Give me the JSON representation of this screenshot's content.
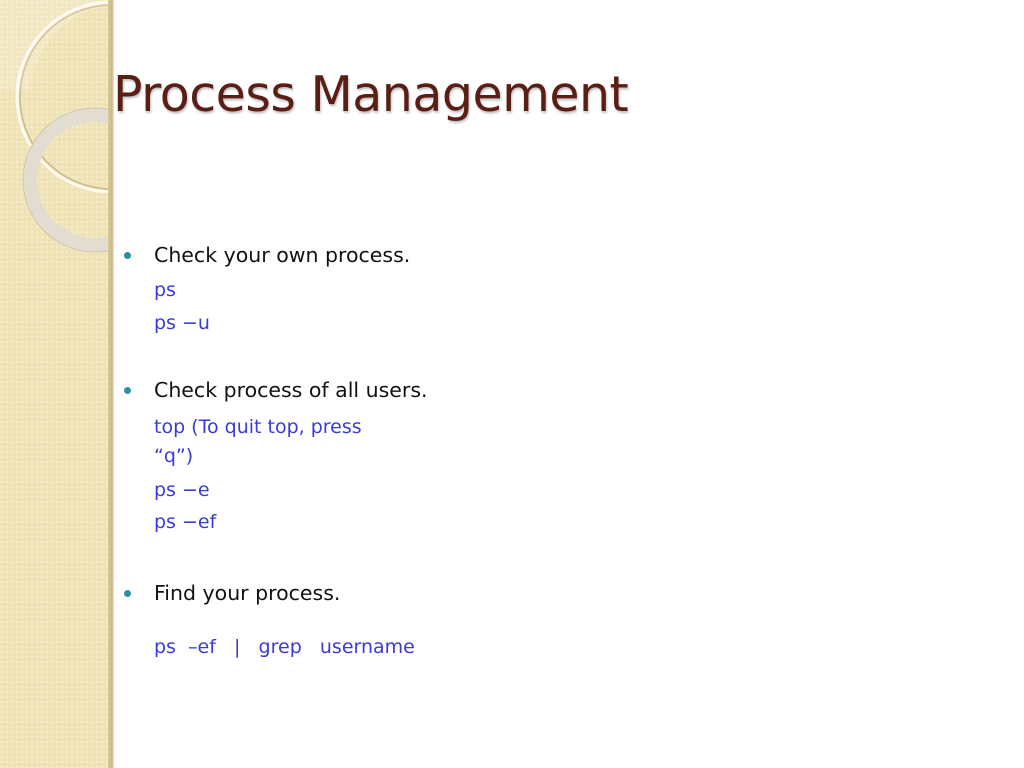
{
  "slide": {
    "title": "Process Management",
    "accent_colors": {
      "title": "#5a1e14",
      "bullet": "#2f8ea8",
      "command": "#3a3ad8",
      "sidebar": "#efe2b4"
    },
    "sections": [
      {
        "bullet": "Check your own process.",
        "commands": [
          "ps",
          "ps  −u"
        ]
      },
      {
        "bullet": "Check process of all users.",
        "commands": [
          "top (To quit top, press",
          "“q”)",
          "ps  −e",
          "ps  −ef"
        ]
      },
      {
        "bullet": "Find your process.",
        "commands": [
          "ps  –ef   |   grep   username"
        ]
      }
    ]
  }
}
